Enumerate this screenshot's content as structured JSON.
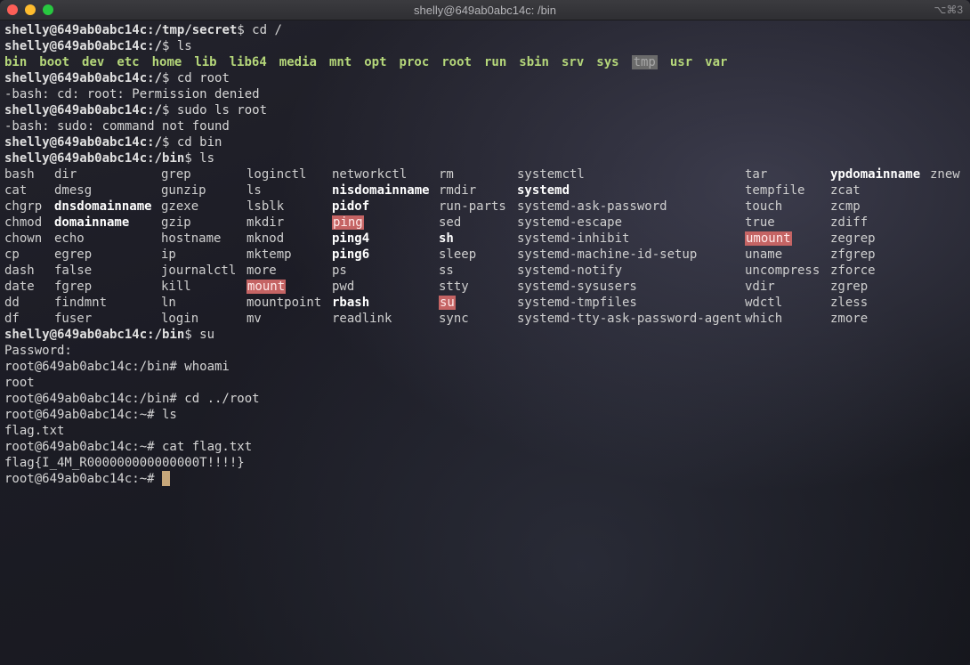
{
  "window": {
    "title": "shelly@649ab0abc14c: /bin",
    "shortcut": "⌥⌘3"
  },
  "lines_top": [
    {
      "user": "shelly@649ab0abc14c",
      "path": ":/tmp/secret",
      "cmd": "$ cd /"
    },
    {
      "user": "shelly@649ab0abc14c",
      "path": ":/",
      "cmd": "$ ls"
    }
  ],
  "root_dirs": [
    "bin",
    "boot",
    "dev",
    "etc",
    "home",
    "lib",
    "lib64",
    "media",
    "mnt",
    "opt",
    "proc",
    "root",
    "run",
    "sbin",
    "srv",
    "sys",
    "tmp",
    "usr",
    "var"
  ],
  "lines_mid": [
    {
      "user": "shelly@649ab0abc14c",
      "path": ":/",
      "cmd": "$ cd root"
    },
    {
      "text": "-bash: cd: root: Permission denied"
    },
    {
      "user": "shelly@649ab0abc14c",
      "path": ":/",
      "cmd": "$ sudo ls root"
    },
    {
      "text": "-bash: sudo: command not found"
    },
    {
      "user": "shelly@649ab0abc14c",
      "path": ":/",
      "cmd": "$ cd bin"
    },
    {
      "user": "shelly@649ab0abc14c",
      "path": ":/bin",
      "cmd": "$ ls"
    }
  ],
  "bin_columns": [
    [
      [
        "bash",
        ""
      ],
      [
        "cat",
        ""
      ],
      [
        "chgrp",
        ""
      ],
      [
        "chmod",
        ""
      ],
      [
        "chown",
        ""
      ],
      [
        "cp",
        ""
      ],
      [
        "dash",
        ""
      ],
      [
        "date",
        ""
      ],
      [
        "dd",
        ""
      ],
      [
        "df",
        ""
      ]
    ],
    [
      [
        "dir",
        ""
      ],
      [
        "dmesg",
        ""
      ],
      [
        "dnsdomainname",
        "b"
      ],
      [
        "domainname",
        "b"
      ],
      [
        "echo",
        ""
      ],
      [
        "egrep",
        ""
      ],
      [
        "false",
        ""
      ],
      [
        "fgrep",
        ""
      ],
      [
        "findmnt",
        ""
      ],
      [
        "fuser",
        ""
      ]
    ],
    [
      [
        "grep",
        ""
      ],
      [
        "gunzip",
        ""
      ],
      [
        "gzexe",
        ""
      ],
      [
        "gzip",
        ""
      ],
      [
        "hostname",
        ""
      ],
      [
        "ip",
        ""
      ],
      [
        "journalctl",
        ""
      ],
      [
        "kill",
        ""
      ],
      [
        "ln",
        ""
      ],
      [
        "login",
        ""
      ]
    ],
    [
      [
        "loginctl",
        ""
      ],
      [
        "ls",
        ""
      ],
      [
        "lsblk",
        ""
      ],
      [
        "mkdir",
        ""
      ],
      [
        "mknod",
        ""
      ],
      [
        "mktemp",
        ""
      ],
      [
        "more",
        ""
      ],
      [
        "mount",
        "r"
      ],
      [
        "mountpoint",
        ""
      ],
      [
        "mv",
        ""
      ]
    ],
    [
      [
        "networkctl",
        ""
      ],
      [
        "nisdomainname",
        "b"
      ],
      [
        "pidof",
        "b"
      ],
      [
        "ping",
        "r"
      ],
      [
        "ping4",
        "b"
      ],
      [
        "ping6",
        "b"
      ],
      [
        "ps",
        ""
      ],
      [
        "pwd",
        ""
      ],
      [
        "rbash",
        "b"
      ],
      [
        "readlink",
        ""
      ]
    ],
    [
      [
        "rm",
        ""
      ],
      [
        "rmdir",
        ""
      ],
      [
        "run-parts",
        ""
      ],
      [
        "sed",
        ""
      ],
      [
        "sh",
        "b"
      ],
      [
        "sleep",
        ""
      ],
      [
        "ss",
        ""
      ],
      [
        "stty",
        ""
      ],
      [
        "su",
        "r"
      ],
      [
        "sync",
        ""
      ]
    ],
    [
      [
        "systemctl",
        ""
      ],
      [
        "systemd",
        "b"
      ],
      [
        "systemd-ask-password",
        ""
      ],
      [
        "systemd-escape",
        ""
      ],
      [
        "systemd-inhibit",
        ""
      ],
      [
        "systemd-machine-id-setup",
        ""
      ],
      [
        "systemd-notify",
        ""
      ],
      [
        "systemd-sysusers",
        ""
      ],
      [
        "systemd-tmpfiles",
        ""
      ],
      [
        "systemd-tty-ask-password-agent",
        ""
      ]
    ],
    [
      [
        "tar",
        ""
      ],
      [
        "tempfile",
        ""
      ],
      [
        "touch",
        ""
      ],
      [
        "true",
        ""
      ],
      [
        "umount",
        "r"
      ],
      [
        "uname",
        ""
      ],
      [
        "uncompress",
        ""
      ],
      [
        "vdir",
        ""
      ],
      [
        "wdctl",
        ""
      ],
      [
        "which",
        ""
      ]
    ],
    [
      [
        "ypdomainname",
        "b"
      ],
      [
        "zcat",
        ""
      ],
      [
        "zcmp",
        ""
      ],
      [
        "zdiff",
        ""
      ],
      [
        "zegrep",
        ""
      ],
      [
        "zfgrep",
        ""
      ],
      [
        "zforce",
        ""
      ],
      [
        "zgrep",
        ""
      ],
      [
        "zless",
        ""
      ],
      [
        "zmore",
        ""
      ]
    ],
    [
      [
        "znew",
        ""
      ]
    ]
  ],
  "lines_bottom": [
    {
      "user": "shelly@649ab0abc14c",
      "path": ":/bin",
      "cmd": "$ su"
    },
    {
      "text": "Password:"
    },
    {
      "text": "root@649ab0abc14c:/bin# whoami"
    },
    {
      "text": "root"
    },
    {
      "text": "root@649ab0abc14c:/bin# cd ../root"
    },
    {
      "text": "root@649ab0abc14c:~# ls"
    },
    {
      "text": "flag.txt"
    },
    {
      "text": "root@649ab0abc14c:~# cat flag.txt"
    },
    {
      "text": "flag{I_4M_R000000000000000T!!!!}"
    }
  ],
  "final_prompt": "root@649ab0abc14c:~# "
}
